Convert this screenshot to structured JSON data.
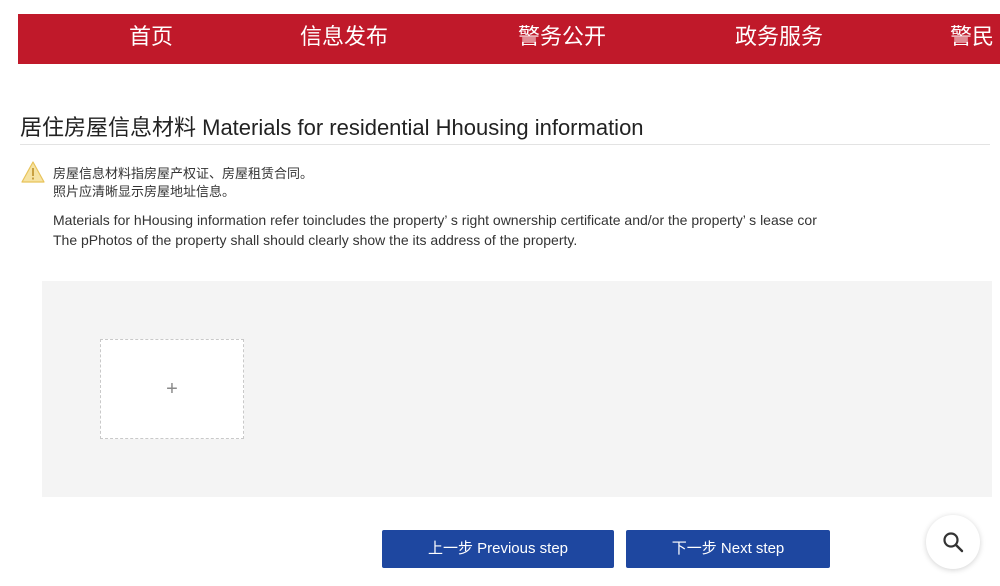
{
  "nav": {
    "items": [
      {
        "label": "首页"
      },
      {
        "label": "信息发布"
      },
      {
        "label": "警务公开"
      },
      {
        "label": "政务服务"
      },
      {
        "label": "警民"
      }
    ]
  },
  "section": {
    "title": "居住房屋信息材料 Materials for residential Hhousing information"
  },
  "notice": {
    "icon": "warning-icon",
    "cn_line1": "房屋信息材料指房屋产权证、房屋租赁合同。",
    "cn_line2": "照片应清晰显示房屋地址信息。",
    "en_line1": "Materials for hHousing information refer toincludes the property’ s right ownership certificate and/or the property’ s lease cor",
    "en_line2": "The pPhotos of the property shall should clearly show the its address of the property."
  },
  "upload": {
    "plus_symbol": "+"
  },
  "buttons": {
    "prev_label": "上一步 Previous step",
    "next_label": "下一步 Next step"
  },
  "colors": {
    "nav_red": "#c0192a",
    "button_blue": "#1e47a0",
    "warning_yellow": "#f2c94c"
  },
  "search": {
    "icon": "search-icon"
  }
}
